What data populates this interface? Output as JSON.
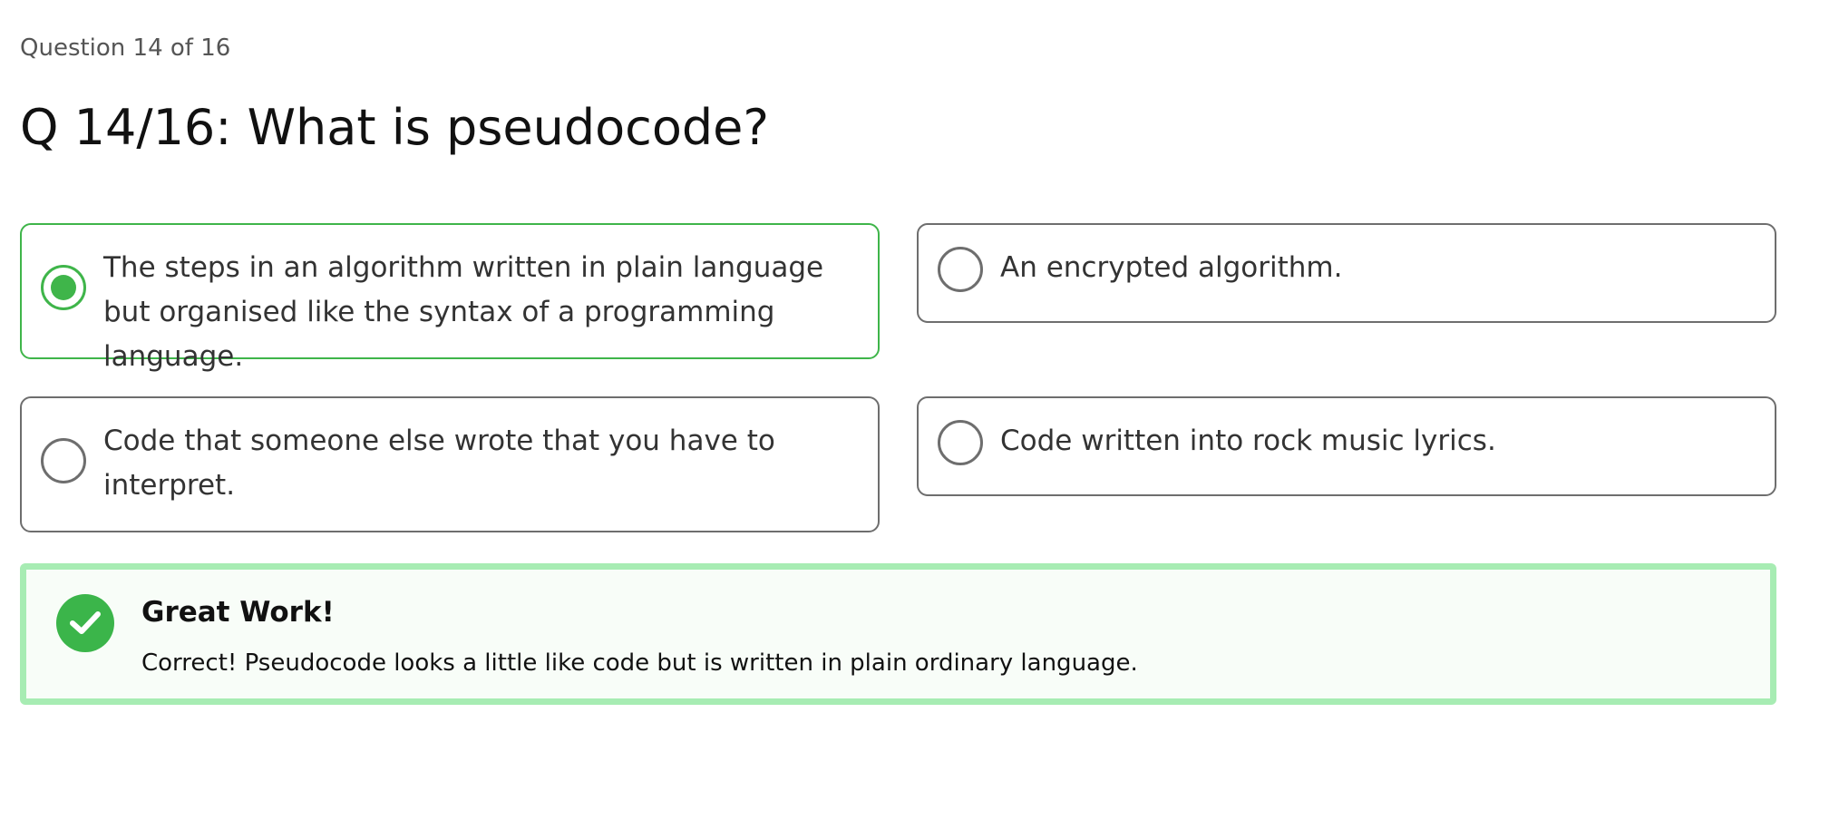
{
  "quiz": {
    "progress_label": "Question 14 of 16",
    "question": "Q 14/16: What is pseudocode?",
    "options": [
      {
        "label": "The steps in an algorithm written in plain language but organised like the syntax of a programming language.",
        "selected": true
      },
      {
        "label": "An encrypted algorithm.",
        "selected": false
      },
      {
        "label": "Code that someone else wrote that you have to interpret.",
        "selected": false
      },
      {
        "label": "Code written into rock music lyrics.",
        "selected": false
      }
    ],
    "feedback": {
      "icon": "check-circle-icon",
      "title": "Great Work!",
      "message": "Correct! Pseudocode looks a little like code but is written in plain ordinary language."
    }
  },
  "colors": {
    "accent_green": "#3fb54a",
    "feedback_border": "#a7ecb3",
    "option_border": "#6e6e6e"
  }
}
